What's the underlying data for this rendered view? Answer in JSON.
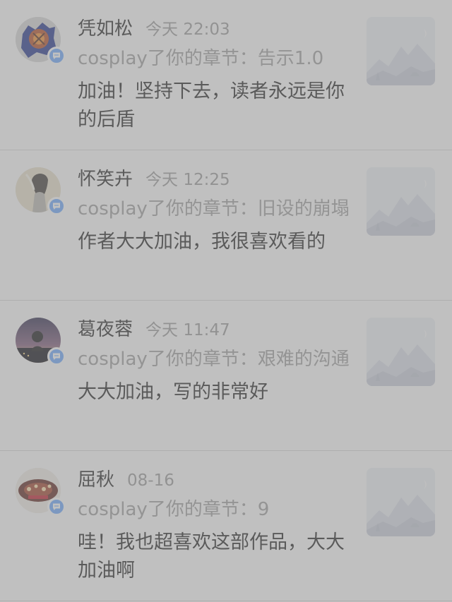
{
  "notifications": [
    {
      "username": "凭如松",
      "time": "今天 22:03",
      "action": "cosplay了你的章节：告示1.0",
      "comment": "加油！坚持下去，读者永远是你的后盾",
      "avatar_icon": "blue-emblem-avatar",
      "badge_icon": "comment-icon",
      "thumb_icon": "mountain-placeholder-icon"
    },
    {
      "username": "怀笑卉",
      "time": "今天 12:25",
      "action": "cosplay了你的章节：旧设的崩塌",
      "comment": "作者大大加油，我很喜欢看的",
      "avatar_icon": "portrait-avatar",
      "badge_icon": "comment-icon",
      "thumb_icon": "mountain-placeholder-icon"
    },
    {
      "username": "葛夜蓉",
      "time": "今天 11:47",
      "action": "cosplay了你的章节：艰难的沟通",
      "comment": "大大加油，写的非常好",
      "avatar_icon": "night-city-avatar",
      "badge_icon": "comment-icon",
      "thumb_icon": "mountain-placeholder-icon"
    },
    {
      "username": "屈秋",
      "time": "08-16",
      "action": "cosplay了你的章节：9",
      "comment": "哇！我也超喜欢这部作品，大大加油啊",
      "avatar_icon": "red-lights-avatar",
      "badge_icon": "comment-icon",
      "thumb_icon": "mountain-placeholder-icon"
    }
  ],
  "theme": {
    "overlay": "#8c8c8c",
    "badge_blue": "#69a7ff"
  }
}
